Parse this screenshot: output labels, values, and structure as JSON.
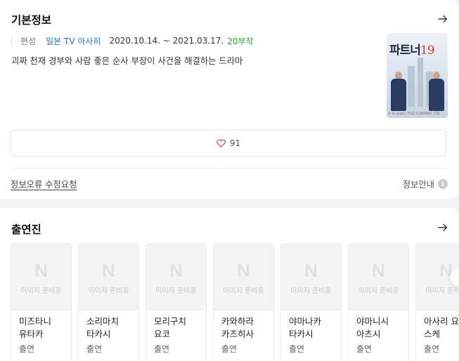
{
  "basic_info": {
    "title": "기본정보",
    "meta_label": "편성",
    "channel": "일본 TV 아사히",
    "dates": "2020.10.14. ~ 2021.03.17.",
    "episodes": "20부작",
    "description": "괴짜 천재 경부와 사람 좋은 순사 부장이 사건을 해결하는 드라마",
    "poster": {
      "title_text": "파트너",
      "title_number": "19",
      "credit": "© tv asahi / TOEI COMPANY, LTD."
    },
    "like_count": "91",
    "report_link": "정보오류 수정요청",
    "info_guide": "정보안내",
    "info_icon_glyph": "i"
  },
  "cast": {
    "title": "출연진",
    "logo_letter": "N",
    "placeholder": "이미지 준비중",
    "members": [
      {
        "name": "미즈타니\n유타카",
        "role": "출연"
      },
      {
        "name": "소리마치\n타카시",
        "role": "출연"
      },
      {
        "name": "모리구치\n요코",
        "role": "출연"
      },
      {
        "name": "카와하라\n카즈히사",
        "role": "출연"
      },
      {
        "name": "야마나카\n타카시",
        "role": "출연"
      },
      {
        "name": "야마니시\n아츠시",
        "role": "출연"
      },
      {
        "name": "아사리 요\n스케",
        "role": "출연"
      }
    ]
  },
  "colors": {
    "channel": "#2b6fd6",
    "episodes": "#1ea934",
    "poster_number": "#e2352d"
  },
  "icons": [
    "arrow-right-icon",
    "heart-icon",
    "info-icon",
    "next-arrow-icon"
  ]
}
